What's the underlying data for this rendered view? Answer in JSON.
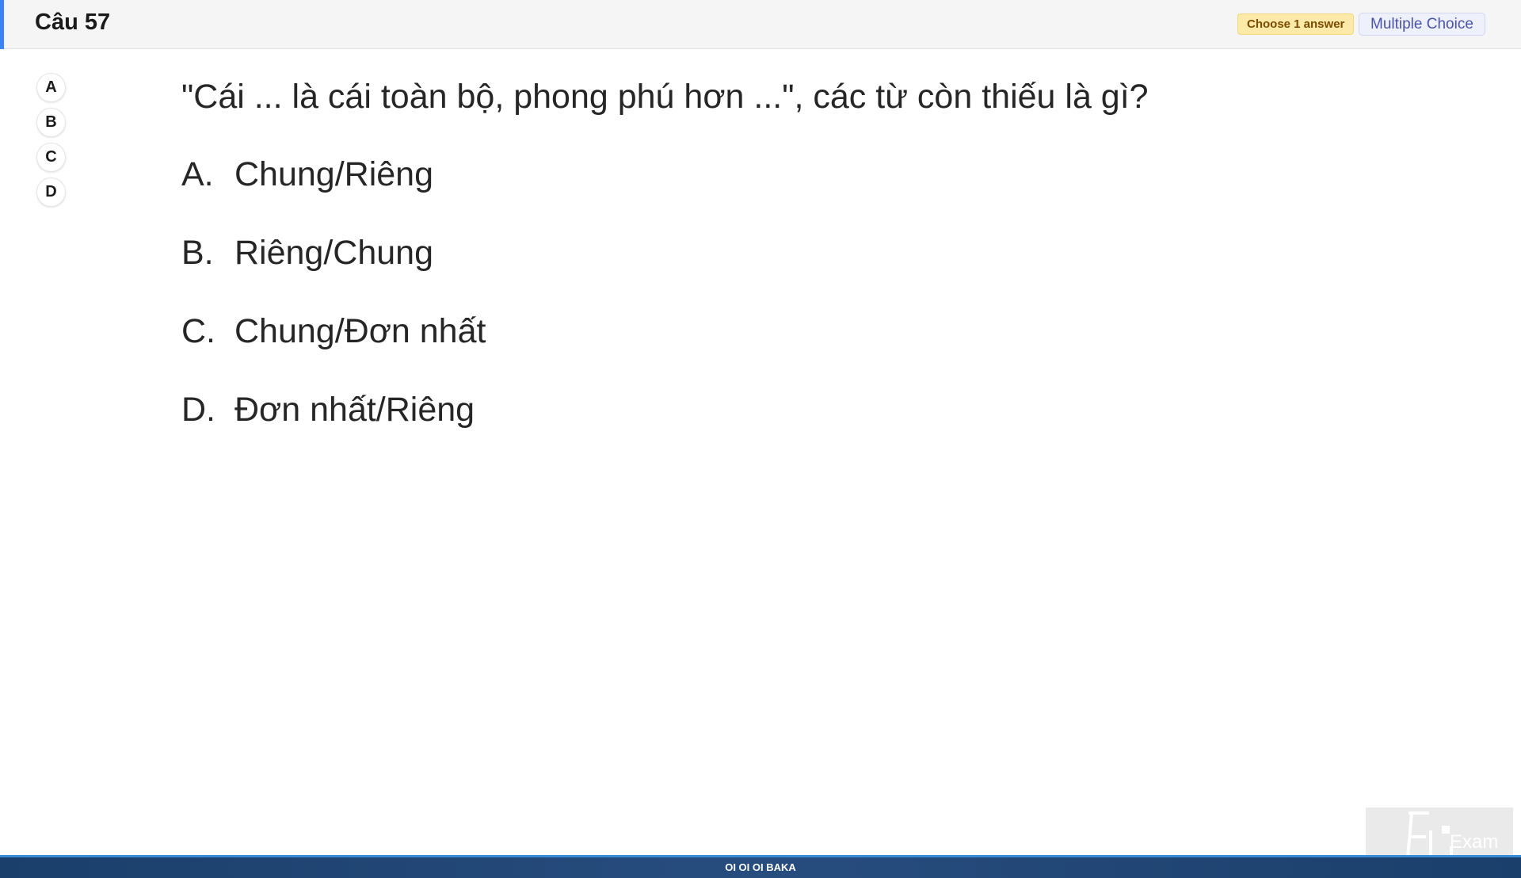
{
  "header": {
    "title": "Câu 57",
    "instruction_badge": "Choose 1 answer",
    "type_badge": "Multiple Choice"
  },
  "answer_selector": {
    "options": [
      "A",
      "B",
      "C",
      "D"
    ]
  },
  "question": {
    "text": "\"Cái ... là cái toàn bộ, phong phú hơn ...\", các từ còn thiếu là gì?",
    "choices": [
      {
        "letter": "A.",
        "text": "Chung/Riêng"
      },
      {
        "letter": "B.",
        "text": "Riêng/Chung"
      },
      {
        "letter": "C.",
        "text": "Chung/Đơn nhất"
      },
      {
        "letter": "D.",
        "text": "Đơn nhất/Riêng"
      }
    ]
  },
  "logo": {
    "text": "Exam",
    "icon": "fu-exam-logo-icon"
  },
  "footer": {
    "text": "OI OI OI BAKA"
  },
  "colors": {
    "accent": "#3b82f6",
    "badge_yellow": "#fde9a8",
    "badge_blue": "#eef0fb",
    "footer_bg": "#1b3f6b"
  }
}
